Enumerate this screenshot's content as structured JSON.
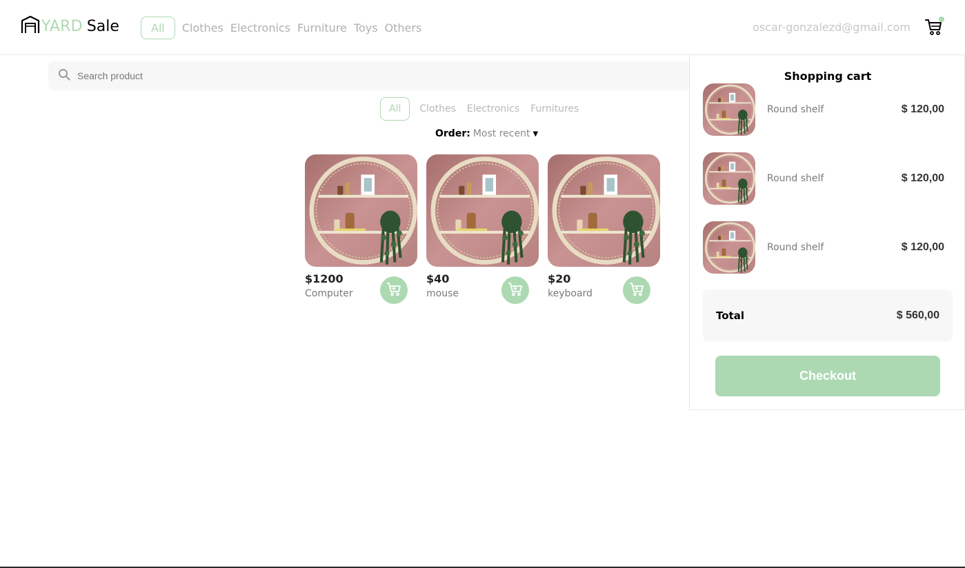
{
  "header": {
    "logo_word_1": "YARD",
    "logo_word_2": "Sale",
    "nav_categories": [
      "All",
      "Clothes",
      "Electronics",
      "Furniture",
      "Toys",
      "Others"
    ],
    "active_category": "All",
    "user_email": "oscar-gonzalezd@gmail.com",
    "cart_icon": "shopping-cart-icon",
    "logo_icon": "garage-icon"
  },
  "search": {
    "placeholder": "Search product",
    "value": "",
    "icon": "search-icon"
  },
  "filters": {
    "tabs": [
      "All",
      "Clothes",
      "Electronics",
      "Furnitures"
    ],
    "active": "All"
  },
  "order": {
    "label": "Order:",
    "value": "Most recent"
  },
  "products": [
    {
      "price": "$1200",
      "name": "Computer",
      "image": "round-shelf-photo"
    },
    {
      "price": "$40",
      "name": "mouse",
      "image": "round-shelf-photo"
    },
    {
      "price": "$20",
      "name": "keyboard",
      "image": "round-shelf-photo"
    }
  ],
  "cart": {
    "title": "Shopping cart",
    "items": [
      {
        "name": "Round shelf",
        "price": "$ 120,00"
      },
      {
        "name": "Round shelf",
        "price": "$ 120,00"
      },
      {
        "name": "Round shelf",
        "price": "$ 120,00"
      }
    ],
    "total_label": "Total",
    "total_value": "$ 560,00",
    "checkout_label": "Checkout"
  },
  "colors": {
    "accent": "#acd9b2",
    "muted_text": "#b0b0b0",
    "panel_bg": "#f7f7f7",
    "shelf_wall": "#c98f8f"
  }
}
